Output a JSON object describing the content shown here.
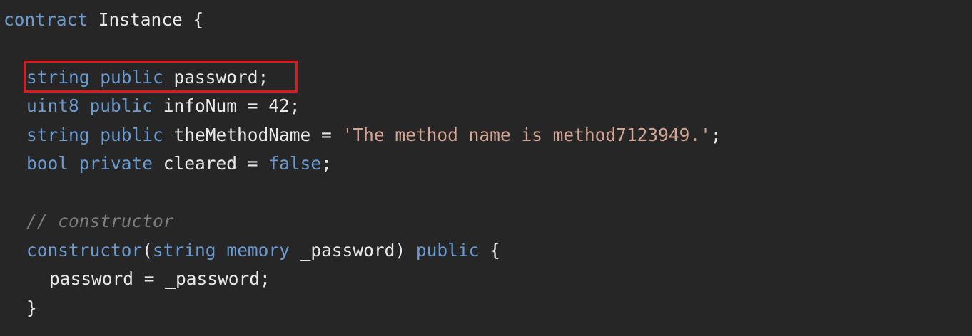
{
  "code": {
    "line1": {
      "kw": "contract",
      "name": " Instance {"
    },
    "line2": {
      "type": "string",
      "vis": "public",
      "rest": " password;"
    },
    "line3": {
      "type": "uint8",
      "vis": "public",
      "rest": " infoNum = 42;"
    },
    "line4": {
      "type": "string",
      "vis": "public",
      "rest": " theMethodName = ",
      "str": "'The method name is method7123949.'",
      "end": ";"
    },
    "line5": {
      "type": "bool",
      "vis": "private",
      "rest": " cleared = ",
      "val": "false",
      "end": ";"
    },
    "line6": {
      "comment": "// constructor"
    },
    "line7": {
      "kw": "constructor",
      "open": "(",
      "type": "string",
      "mem": "memory",
      "param": " _password) ",
      "vis": "public",
      "brace": " {"
    },
    "line8": {
      "stmt": "password = _password;"
    },
    "line9": {
      "close": "}"
    }
  },
  "colors": {
    "background": "#262626",
    "keyword": "#6b9bd1",
    "string": "#d4a594",
    "comment": "#7d7d7d",
    "text": "#e8e8e8",
    "highlight": "#e0181d"
  }
}
